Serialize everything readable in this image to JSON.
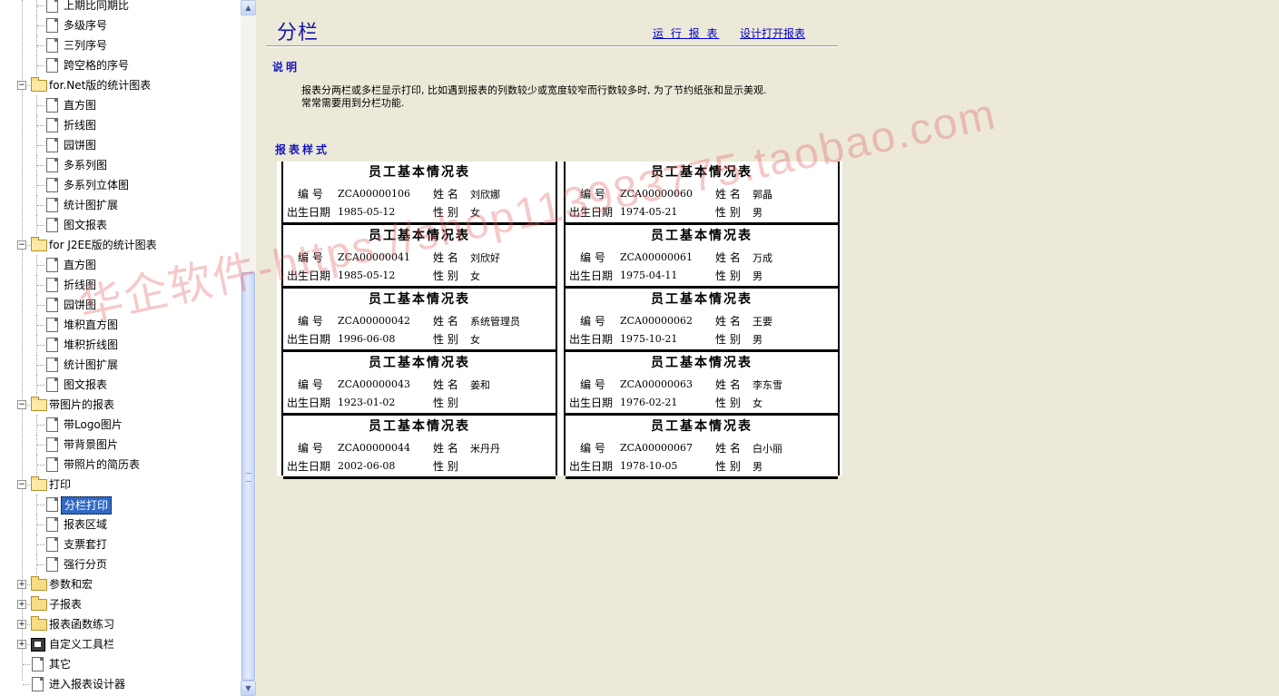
{
  "tree": {
    "items": [
      {
        "label": "上期比同期比",
        "kind": "doc",
        "level": 2
      },
      {
        "label": "多级序号",
        "kind": "doc",
        "level": 2
      },
      {
        "label": "三列序号",
        "kind": "doc",
        "level": 2
      },
      {
        "label": "跨空格的序号",
        "kind": "doc",
        "level": 2
      },
      {
        "label": "for.Net版的统计图表",
        "kind": "folder-open",
        "level": 1
      },
      {
        "label": "直方图",
        "kind": "doc",
        "level": 2
      },
      {
        "label": "折线图",
        "kind": "doc",
        "level": 2
      },
      {
        "label": "园饼图",
        "kind": "doc",
        "level": 2
      },
      {
        "label": "多系列图",
        "kind": "doc",
        "level": 2
      },
      {
        "label": "多系列立体图",
        "kind": "doc",
        "level": 2
      },
      {
        "label": "统计图扩展",
        "kind": "doc",
        "level": 2
      },
      {
        "label": "图文报表",
        "kind": "doc",
        "level": 2
      },
      {
        "label": "for J2EE版的统计图表",
        "kind": "folder-open",
        "level": 1
      },
      {
        "label": "直方图",
        "kind": "doc",
        "level": 2
      },
      {
        "label": "折线图",
        "kind": "doc",
        "level": 2
      },
      {
        "label": "园饼图",
        "kind": "doc",
        "level": 2
      },
      {
        "label": "堆积直方图",
        "kind": "doc",
        "level": 2
      },
      {
        "label": "堆积折线图",
        "kind": "doc",
        "level": 2
      },
      {
        "label": "统计图扩展",
        "kind": "doc",
        "level": 2
      },
      {
        "label": "图文报表",
        "kind": "doc",
        "level": 2
      },
      {
        "label": "带图片的报表",
        "kind": "folder-open",
        "level": 1
      },
      {
        "label": "带Logo图片",
        "kind": "doc",
        "level": 2
      },
      {
        "label": "带背景图片",
        "kind": "doc",
        "level": 2
      },
      {
        "label": "带照片的简历表",
        "kind": "doc",
        "level": 2
      },
      {
        "label": "打印",
        "kind": "folder-open",
        "level": 1
      },
      {
        "label": "分栏打印",
        "kind": "doc",
        "level": 2,
        "selected": true
      },
      {
        "label": "报表区域",
        "kind": "doc",
        "level": 2
      },
      {
        "label": "支票套打",
        "kind": "doc",
        "level": 2
      },
      {
        "label": "强行分页",
        "kind": "doc",
        "level": 2
      },
      {
        "label": "参数和宏",
        "kind": "folder-closed",
        "level": 1
      },
      {
        "label": "子报表",
        "kind": "folder-closed",
        "level": 1
      },
      {
        "label": "报表函数练习",
        "kind": "folder-closed",
        "level": 1
      },
      {
        "label": "自定义工具栏",
        "kind": "tool",
        "level": 1
      },
      {
        "label": "其它",
        "kind": "doc",
        "level": 1
      },
      {
        "label": "进入报表设计器",
        "kind": "doc",
        "level": 1
      }
    ]
  },
  "content": {
    "title": "分栏",
    "run_link": "运 行 报 表",
    "design_link": "设计打开报表",
    "section_desc": "说明",
    "desc_line1": "报表分两栏或多栏显示打印, 比如遇到报表的列数较少或宽度较窄而行数较多时, 为了节约纸张和显示美观.",
    "desc_line2": "常常需要用到分栏功能.",
    "section_sample": "报表样式"
  },
  "report": {
    "card_title": "员工基本情况表",
    "label_no": "编 号",
    "label_name": "姓 名",
    "label_birth": "出生日期",
    "label_sex": "性 别",
    "left": [
      {
        "no": "ZCA00000106",
        "name": "刘欣娜",
        "birth": "1985-05-12",
        "sex": "女"
      },
      {
        "no": "ZCA00000041",
        "name": "刘欣好",
        "birth": "1985-05-12",
        "sex": "女"
      },
      {
        "no": "ZCA00000042",
        "name": "系统管理员",
        "birth": "1996-06-08",
        "sex": "女"
      },
      {
        "no": "ZCA00000043",
        "name": "姜和",
        "birth": "1923-01-02",
        "sex": ""
      },
      {
        "no": "ZCA00000044",
        "name": "米丹丹",
        "birth": "2002-06-08",
        "sex": ""
      }
    ],
    "right": [
      {
        "no": "ZCA00000060",
        "name": "郭晶",
        "birth": "1974-05-21",
        "sex": "男"
      },
      {
        "no": "ZCA00000061",
        "name": "万成",
        "birth": "1975-04-11",
        "sex": "男"
      },
      {
        "no": "ZCA00000062",
        "name": "王要",
        "birth": "1975-10-21",
        "sex": "男"
      },
      {
        "no": "ZCA00000063",
        "name": "李东雪",
        "birth": "1976-02-21",
        "sex": "女"
      },
      {
        "no": "ZCA00000067",
        "name": "白小丽",
        "birth": "1978-10-05",
        "sex": "男"
      }
    ]
  },
  "watermark": "华企软件-https://shop113983775.taobao.com",
  "colors": {
    "accent": "#1515A8",
    "link": "#0000CC",
    "selection": "#316AC5",
    "background": "#ECE9D8"
  }
}
